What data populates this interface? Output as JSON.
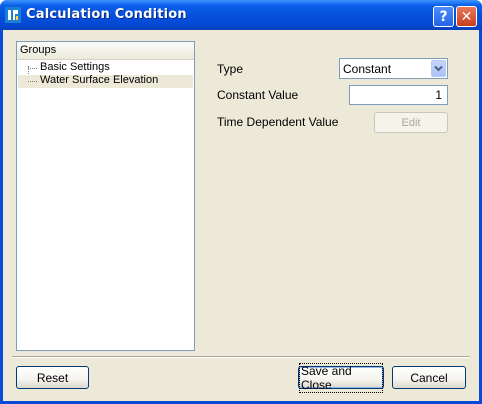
{
  "window": {
    "title": "Calculation Condition",
    "help_label": "?",
    "close_label": "✕"
  },
  "groups": {
    "header": "Groups",
    "items": [
      {
        "label": "Basic Settings",
        "selected": false
      },
      {
        "label": "Water Surface Elevation",
        "selected": true
      }
    ]
  },
  "form": {
    "type_label": "Type",
    "type_value": "Constant",
    "constant_label": "Constant Value",
    "constant_value": "1",
    "time_dependent_label": "Time Dependent Value",
    "edit_label": "Edit"
  },
  "footer": {
    "reset_label": "Reset",
    "save_label": "Save and Close",
    "cancel_label": "Cancel"
  },
  "colors": {
    "titlebar": "#0651df",
    "client": "#ece9d8",
    "selection": "#ece9d8",
    "disabled_text": "#aca899"
  }
}
